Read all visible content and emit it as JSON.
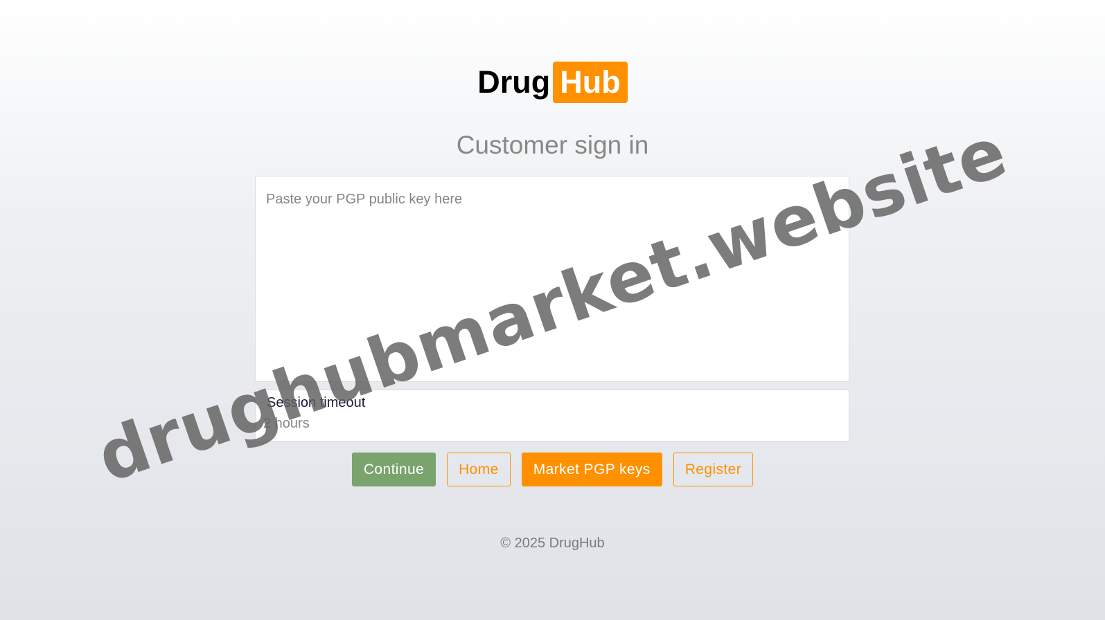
{
  "logo": {
    "part1": "Drug",
    "part2": "Hub",
    "accent_color": "#ff9000"
  },
  "page": {
    "title": "Customer sign in"
  },
  "form": {
    "pgp_key_placeholder": "Paste your PGP public key here",
    "pgp_key_value": "",
    "session_timeout_label": "Session timeout",
    "session_timeout_value": "2 hours"
  },
  "buttons": {
    "continue": "Continue",
    "home": "Home",
    "market_pgp_keys": "Market PGP keys",
    "register": "Register"
  },
  "colors": {
    "continue_green": "#7aa36e",
    "brand_orange": "#ff9000"
  },
  "footer": {
    "copyright": "© 2025 DrugHub"
  },
  "watermark": {
    "text": "drughubmarket.website"
  }
}
